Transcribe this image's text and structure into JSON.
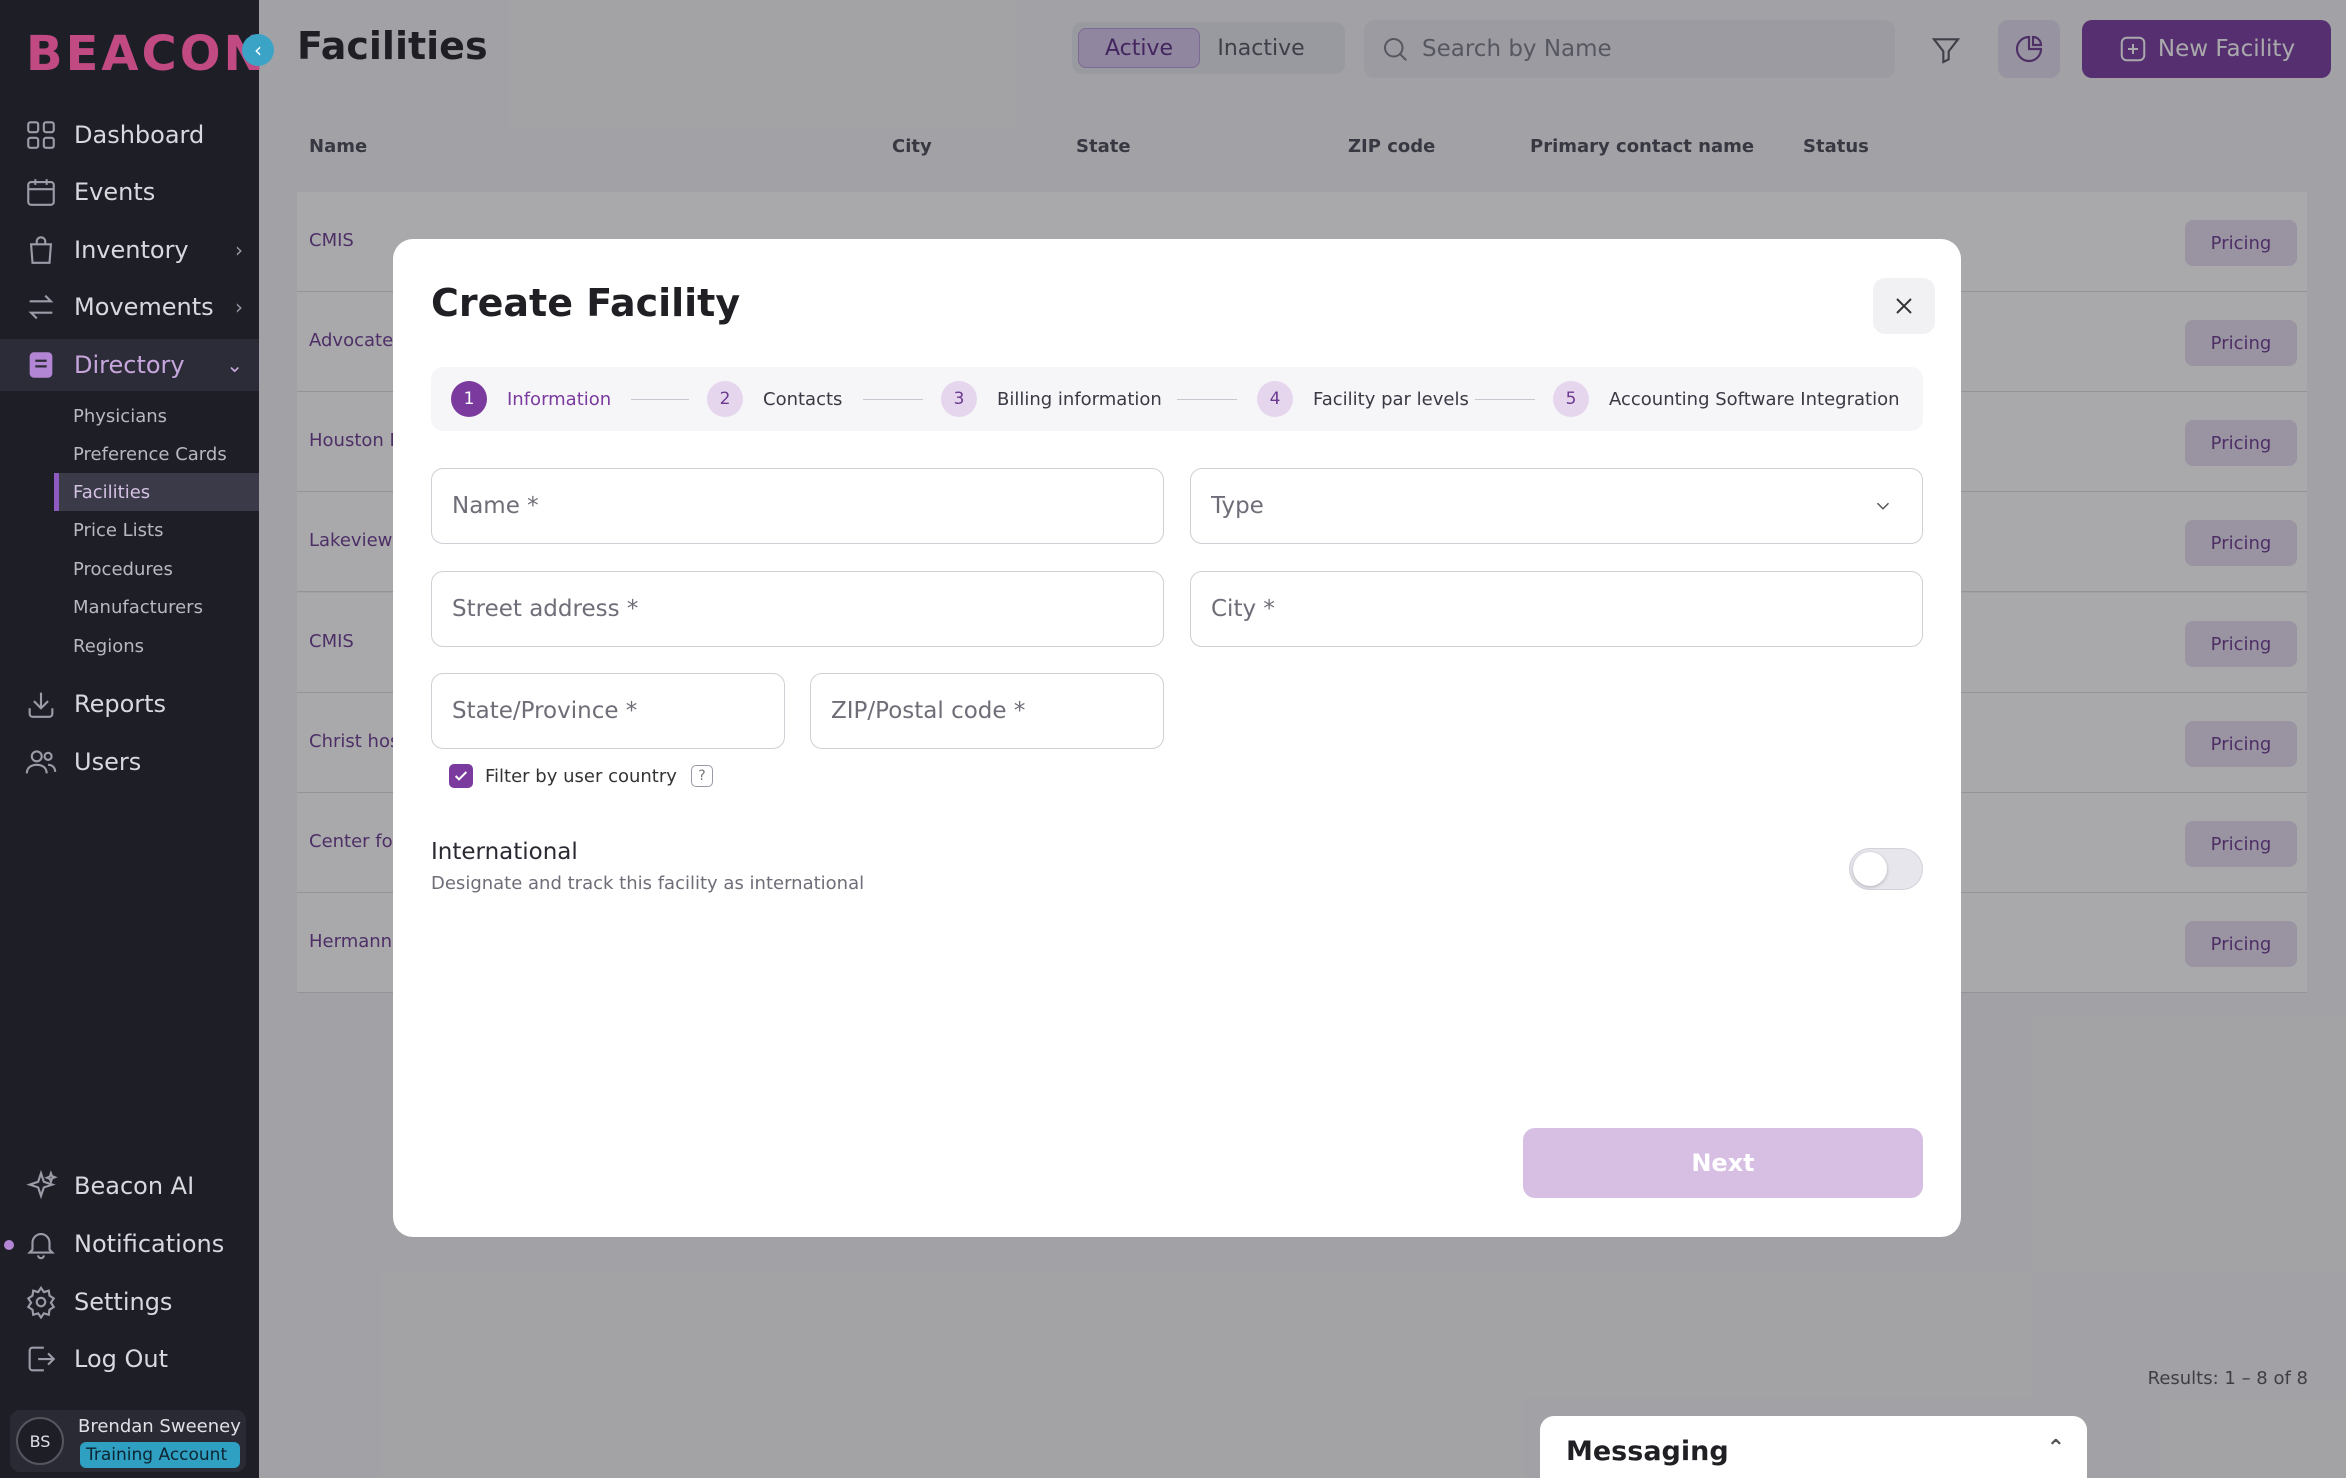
{
  "brand": {
    "logo_text": "BEACON",
    "logo_color": "#c14a82",
    "accent": "#7a3a9e"
  },
  "sidebar": {
    "collapse_icon": "chevron-left-icon",
    "items": [
      {
        "label": "Dashboard",
        "icon": "grid-icon"
      },
      {
        "label": "Events",
        "icon": "calendar-icon"
      },
      {
        "label": "Inventory",
        "icon": "bag-icon"
      },
      {
        "label": "Movements",
        "icon": "arrows-icon"
      },
      {
        "label": "Directory",
        "icon": "book-icon"
      }
    ],
    "sub_items": [
      "Physicians",
      "Preference Cards",
      "Facilities",
      "Price Lists",
      "Procedures",
      "Manufacturers",
      "Regions"
    ],
    "lower_items": [
      {
        "label": "Reports",
        "icon": "download-icon"
      },
      {
        "label": "Users",
        "icon": "users-icon"
      }
    ],
    "bottom_items": [
      {
        "label": "Beacon AI",
        "icon": "sparkle-icon"
      },
      {
        "label": "Notifications",
        "icon": "bell-icon"
      },
      {
        "label": "Settings",
        "icon": "gear-icon"
      },
      {
        "label": "Log Out",
        "icon": "logout-icon"
      }
    ],
    "user": {
      "initials": "BS",
      "name": "Brendan Sweeney",
      "account": "Training Account"
    }
  },
  "header": {
    "title": "Facilities",
    "segments": [
      "Active",
      "Inactive"
    ],
    "search_placeholder": "Search by Name",
    "new_button": "New Facility"
  },
  "table": {
    "columns": [
      "Name",
      "City",
      "State",
      "ZIP code",
      "Primary contact name",
      "Status"
    ],
    "rows": [
      {
        "name": "CMIS",
        "action": "Pricing"
      },
      {
        "name": "Advocate",
        "action": "Pricing"
      },
      {
        "name": "Houston F",
        "action": "Pricing"
      },
      {
        "name": "Lakeview",
        "action": "Pricing"
      },
      {
        "name": "CMIS",
        "action": "Pricing"
      },
      {
        "name": "Christ hos",
        "action": "Pricing"
      },
      {
        "name": "Center fo",
        "action": "Pricing"
      },
      {
        "name": "Hermann",
        "action": "Pricing"
      }
    ],
    "results": "Results: 1 – 8 of 8"
  },
  "messaging": {
    "title": "Messaging"
  },
  "modal": {
    "title": "Create Facility",
    "steps": [
      {
        "num": "1",
        "label": "Information"
      },
      {
        "num": "2",
        "label": "Contacts"
      },
      {
        "num": "3",
        "label": "Billing information"
      },
      {
        "num": "4",
        "label": "Facility par levels"
      },
      {
        "num": "5",
        "label": "Accounting Software Integration"
      }
    ],
    "fields": {
      "name": "Name *",
      "type": "Type",
      "street": "Street address *",
      "city": "City *",
      "state": "State/Province *",
      "zip": "ZIP/Postal code *"
    },
    "checkbox_label": "Filter by user country",
    "help_glyph": "?",
    "international_title": "International",
    "international_desc": "Designate and track this facility as international",
    "next_label": "Next"
  }
}
